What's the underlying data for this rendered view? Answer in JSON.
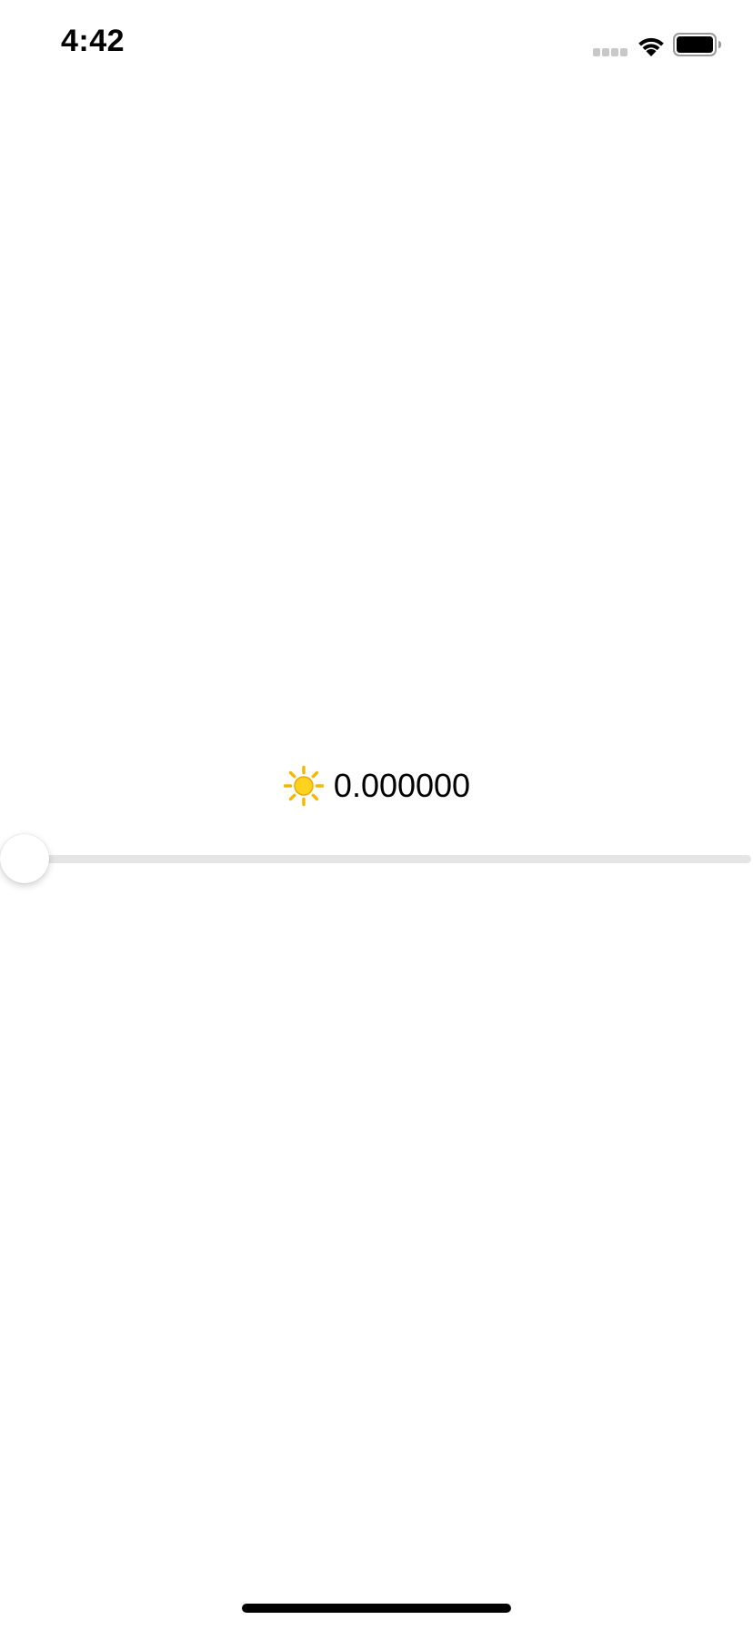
{
  "status_bar": {
    "time": "4:42",
    "signal_icon": "cellular-signal-icon",
    "wifi_icon": "wifi-icon",
    "battery_icon": "battery-icon"
  },
  "brightness": {
    "icon": "sun-icon",
    "value_label": "0.000000"
  },
  "slider": {
    "value": 0.0,
    "min": 0.0,
    "max": 1.0,
    "track_color": "#e5e5e5",
    "thumb_color": "#ffffff"
  },
  "colors": {
    "background": "#ffffff",
    "text": "#000000",
    "sun": "#f5b800"
  }
}
